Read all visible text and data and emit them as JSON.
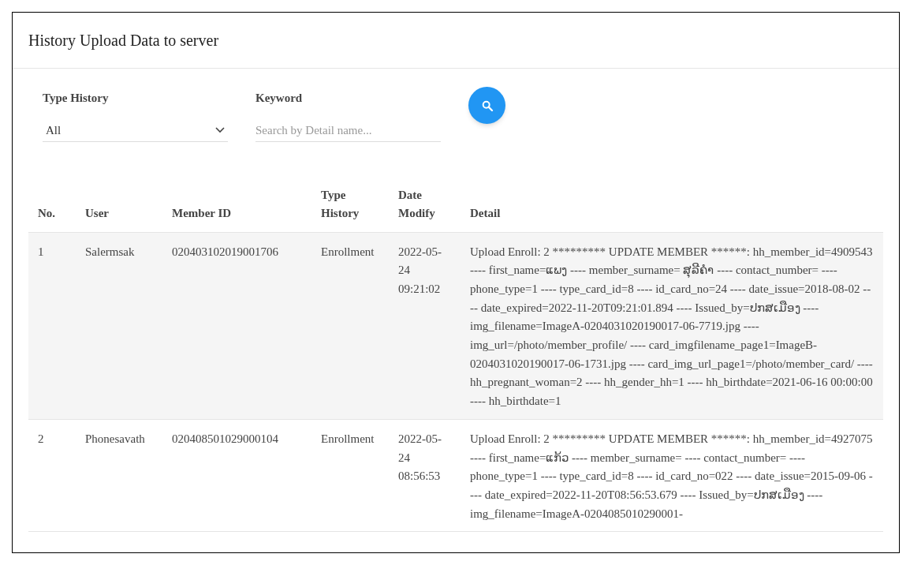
{
  "page": {
    "title": "History Upload Data to server"
  },
  "filters": {
    "type_label": "Type History",
    "type_value": "All",
    "keyword_label": "Keyword",
    "keyword_placeholder": "Search by Detail name..."
  },
  "table": {
    "columns": [
      "No.",
      "User",
      "Member ID",
      "Type History",
      "Date Modify",
      "Detail"
    ],
    "rows": [
      {
        "no": "1",
        "user": "Salermsak",
        "member_id": "020403102019001706",
        "type": "Enrollment",
        "date": "2022-05-24 09:21:02",
        "detail": "Upload Enroll: 2 ********* UPDATE MEMBER ******: hh_member_id=4909543 ---- first_name=ແພງ ---- member_surname= ສຸລີຄໍາ ---- contact_number= ---- phone_type=1 ---- type_card_id=8 ---- id_card_no=24 ---- date_issue=2018-08-02 ---- date_expired=2022-11-20T09:21:01.894 ---- Issued_by=ປກສເມືອງ ---- img_filename=ImageA-0204031020190017-06-7719.jpg ---- img_url=/photo/member_profile/ ---- card_imgfilename_page1=ImageB-0204031020190017-06-1731.jpg ---- card_img_url_page1=/photo/member_card/ ---- hh_pregnant_woman=2 ---- hh_gender_hh=1 ---- hh_birthdate=2021-06-16 00:00:00 ---- hh_birthdate=1"
      },
      {
        "no": "2",
        "user": "Phonesavath",
        "member_id": "020408501029000104",
        "type": "Enrollment",
        "date": "2022-05-24 08:56:53",
        "detail": "Upload Enroll: 2 ********* UPDATE MEMBER ******: hh_member_id=4927075 ---- first_name=ແກ້ວ ---- member_surname= ---- contact_number= ---- phone_type=1 ---- type_card_id=8 ---- id_card_no=022 ---- date_issue=2015-09-06 ---- date_expired=2022-11-20T08:56:53.679 ---- Issued_by=ປກສເມືອງ ---- img_filename=ImageA-0204085010290001-"
      }
    ]
  }
}
